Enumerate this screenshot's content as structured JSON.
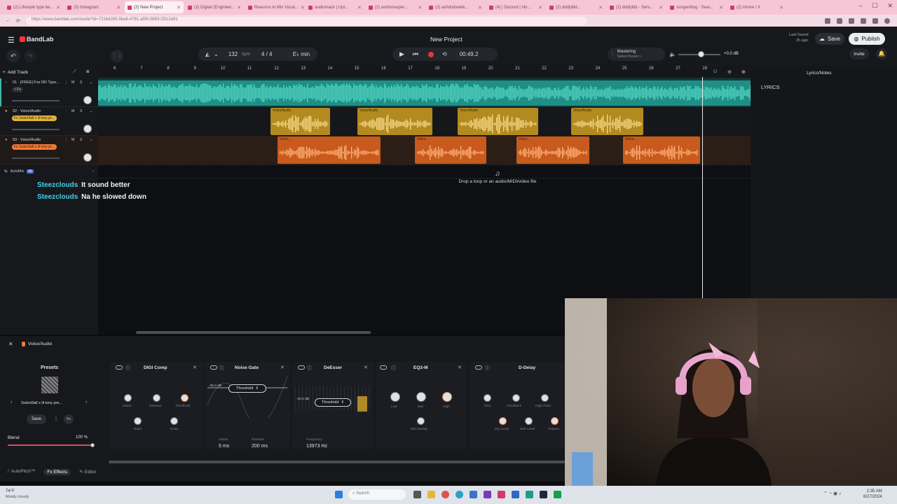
{
  "browser": {
    "tabs": [
      "(2) Lifestyle type be...",
      "(3) Instagram",
      "(2) New Project",
      "(2) Digital (Engineer...",
      "Reasons to Mix Vocal...",
      "audiomack | Upl...",
      "(2) ashtonsuper...",
      "(2) ashdsdsdelk...",
      "(4) | Discord | #lo...",
      "(2) ddd|ddd...",
      "(2) ddd|ddd - Serv...",
      "songwriting - Sear...",
      "(2) Home / X"
    ],
    "url": "https://www.bandlab.com/studio?id=7316d265-5ba8-4781-a5fb-5883-2f2c2e81",
    "window_controls": [
      "–",
      "☐",
      "✕"
    ]
  },
  "app": {
    "brand": "BandLab",
    "project_title": "New Project",
    "last_saved_label": "Last Saved",
    "last_saved_time": "2h ago",
    "save_label": "Save",
    "publish_label": "Publish",
    "invite_label": "Invite",
    "bpm": "132",
    "bpm_unit": "bpm",
    "time_sig": "4 / 4",
    "key": "E♭ min",
    "time": "00:49.2",
    "mastering_label": "Mastering",
    "mastering_sub": "Select Preset >",
    "volume_db": "+0.0 dB",
    "add_track_label": "Add Track",
    "lyrics_panel_title": "Lyrics/Notes",
    "lyrics_heading": "LYRICS",
    "automix_label": "AutoMix",
    "automix_badge": "AI",
    "drop_hint": "Drop a loop or an audio/MIDI/video file"
  },
  "ruler": [
    "6",
    "7",
    "8",
    "9",
    "10",
    "11",
    "12",
    "13",
    "14",
    "15",
    "16",
    "17",
    "18",
    "19",
    "20",
    "21",
    "22",
    "23",
    "24",
    "25",
    "26",
    "27",
    "28"
  ],
  "tracks": [
    {
      "name": "01 · [FREE] Fox RD Type...",
      "fx": "+ Fx",
      "color": "#3fb8a5"
    },
    {
      "name": "02 · Voice/Audio",
      "fx": "Fx 2sdxrt3all x lil tony pr...",
      "color": "#e0b33c"
    },
    {
      "name": "03 · Voice/Audio",
      "fx": "Fx 2sdxrt3all x lil tony pr...",
      "color": "#f07a35"
    }
  ],
  "clips": {
    "voice_label": "Voice/Audio",
    "voice_short": "Voice..."
  },
  "chat": [
    {
      "user": "Steezclouds",
      "msg": "It sound better"
    },
    {
      "user": "Steezclouds",
      "msg": "Na he slowed down"
    }
  ],
  "fx": {
    "header": "Voice/Audio",
    "presets_label": "Presets",
    "preset_name": "2sdxrt3all x lil tony pre...",
    "save_label": "Save",
    "blend_label": "Blend",
    "blend_value": "100 %",
    "blend_level": 1.0,
    "digi_comp": {
      "name": "DIGI Comp",
      "knobs": [
        "Attack",
        "Release",
        "Threshold",
        "Ratio",
        "Knee"
      ]
    },
    "noise_gate": {
      "name": "Noise Gate",
      "threshold": "Threshold",
      "db": "-35.0 dB",
      "attack_label": "Attack",
      "attack_value": "5 ms",
      "release_label": "Release",
      "release_value": "200 ms"
    },
    "deesser": {
      "name": "DeEsser",
      "threshold": "Threshold",
      "db": "-20.0 dB",
      "freq_label": "Frequency",
      "freq_value": "13973 Hz"
    },
    "eq3": {
      "name": "EQ3-M",
      "knobs": [
        "Low",
        "Mid",
        "High",
        "Mid Sweep"
      ]
    },
    "delay": {
      "name": "D-Delay",
      "knobs": [
        "Time",
        "Feedback",
        "High Pass",
        "Dry Level",
        "Wet Level",
        "Volume"
      ]
    },
    "tabs": [
      "AutoPitch™",
      "Effects",
      "Editor"
    ]
  },
  "taskbar": {
    "weather_temp": "74°F",
    "weather_desc": "Mostly cloudy",
    "search_placeholder": "Search",
    "clock_time": "2:35 AM",
    "clock_date": "6/27/2024"
  }
}
